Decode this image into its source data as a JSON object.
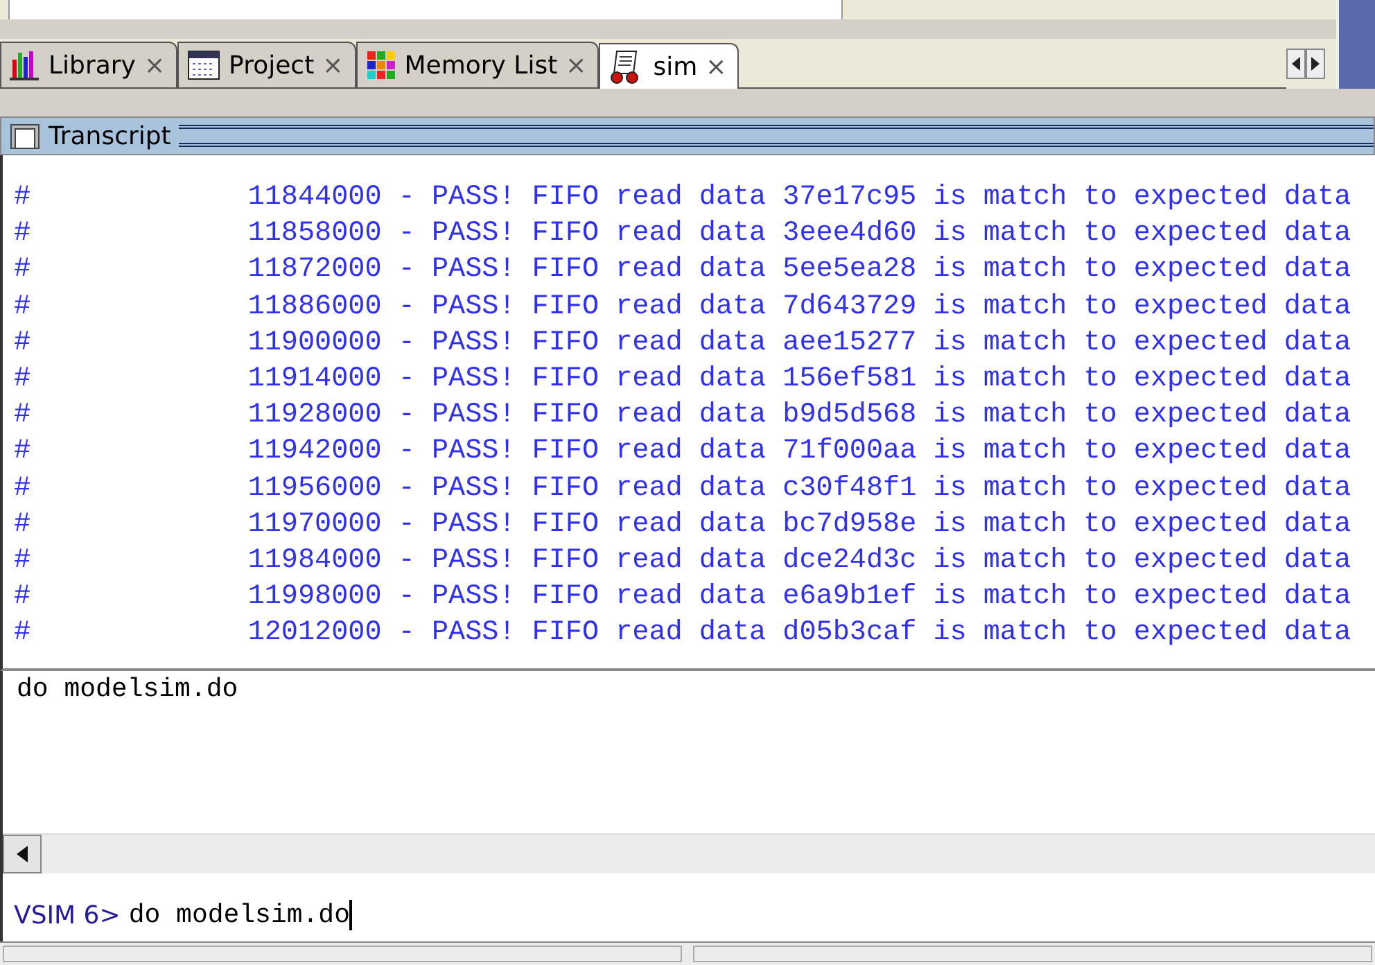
{
  "tabs": [
    {
      "label": "Library",
      "kind": "library",
      "selected": false,
      "close": "×"
    },
    {
      "label": "Project",
      "kind": "project",
      "selected": false,
      "close": "×"
    },
    {
      "label": "Memory List",
      "kind": "memory",
      "selected": false,
      "close": "×"
    },
    {
      "label": "sim",
      "kind": "sim",
      "selected": true,
      "close": "×"
    }
  ],
  "panel": {
    "title": "Transcript"
  },
  "transcript": [
    "#             11844000 - PASS! FIFO read data 37e17c95 is match to expected data",
    "#             11858000 - PASS! FIFO read data 3eee4d60 is match to expected data",
    "#             11872000 - PASS! FIFO read data 5ee5ea28 is match to expected data",
    "#             11886000 - PASS! FIFO read data 7d643729 is match to expected data",
    "#             11900000 - PASS! FIFO read data aee15277 is match to expected data",
    "#             11914000 - PASS! FIFO read data 156ef581 is match to expected data",
    "#             11928000 - PASS! FIFO read data b9d5d568 is match to expected data",
    "#             11942000 - PASS! FIFO read data 71f000aa is match to expected data",
    "#             11956000 - PASS! FIFO read data c30f48f1 is match to expected data",
    "#             11970000 - PASS! FIFO read data bc7d958e is match to expected data",
    "#             11984000 - PASS! FIFO read data dce24d3c is match to expected data",
    "#             11998000 - PASS! FIFO read data e6a9b1ef is match to expected data",
    "#             12012000 - PASS! FIFO read data d05b3caf is match to expected data"
  ],
  "command_history": [
    "do modelsim.do"
  ],
  "prompt": {
    "label": "VSIM 6>",
    "value": "do modelsim.do"
  }
}
